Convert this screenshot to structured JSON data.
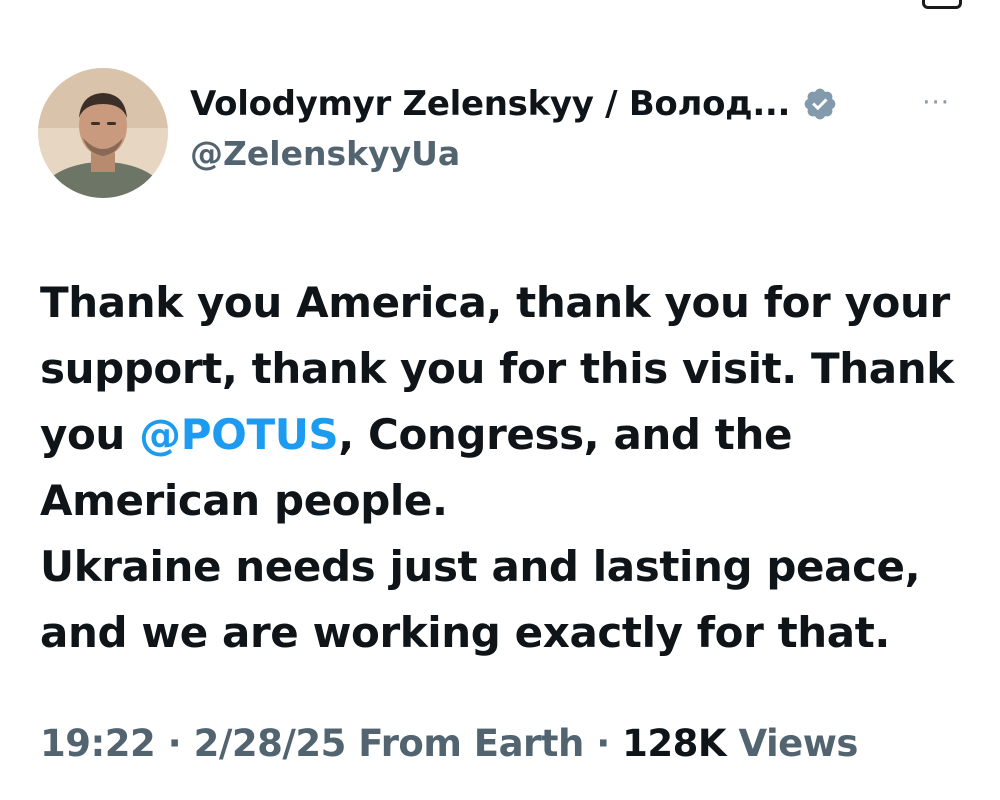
{
  "author": {
    "display_name": "Volodymyr Zelenskyy / Волод...",
    "handle": "@ZelenskyyUa",
    "verified_icon": "verified-badge-icon",
    "avatar_colors": {
      "skin": "#c99a7e",
      "shirt": "#6d7567",
      "background": "#e7d6c2"
    }
  },
  "more_icon": "more-options-icon",
  "more_glyph": "···",
  "tweet": {
    "line1_text_before": "Thank you America, thank you for your support, thank you for this visit. Thank you ",
    "mention": "@POTUS",
    "line1_text_after": ", Congress, and the American people.",
    "line2": "Ukraine needs just and lasting peace, and we are working exactly for that."
  },
  "meta": {
    "time": "19:22",
    "separator": "·",
    "date": "2/28/25",
    "source": "From Earth",
    "views_count": "128K",
    "views_label": "Views"
  },
  "colors": {
    "text": "#0f1419",
    "secondary": "#536471",
    "accent": "#1d9bf0"
  }
}
